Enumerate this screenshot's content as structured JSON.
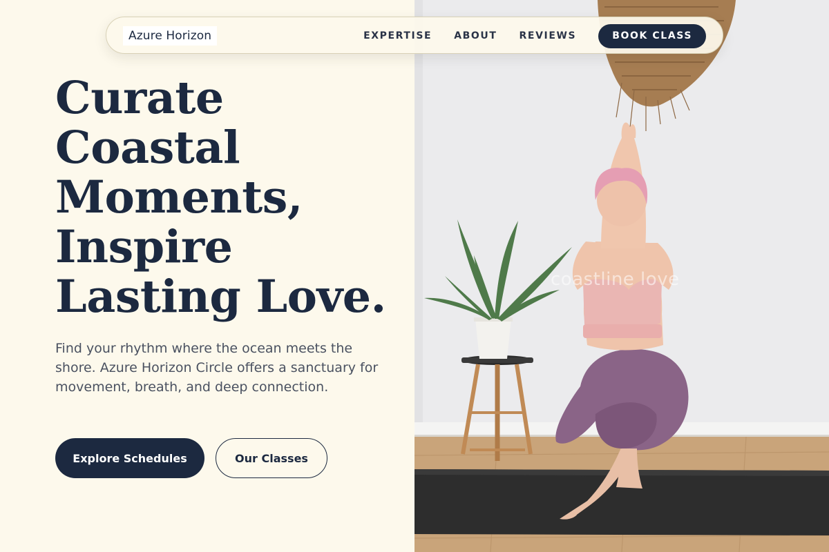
{
  "brand": {
    "name": "Azure Horizon"
  },
  "nav": {
    "links": [
      {
        "label": "EXPERTISE"
      },
      {
        "label": "ABOUT"
      },
      {
        "label": "REVIEWS"
      }
    ],
    "cta": "BOOK CLASS"
  },
  "hero": {
    "title_lines": [
      "Curate",
      "Coastal",
      "Moments,",
      "Inspire",
      "Lasting Love."
    ],
    "subtitle": "Find your rhythm where the ocean meets the shore. Azure Horizon Circle offers a sanctuary for movement, breath, and deep connection.",
    "primary_button": "Explore Schedules",
    "secondary_button": "Our Classes"
  },
  "photo": {
    "watermark": "coastline love",
    "subject": "yoga-practitioner-in-eagle-pose",
    "props": [
      "woven-pendant-lamp",
      "aloe-plant",
      "wooden-stool",
      "yoga-mat"
    ]
  },
  "colors": {
    "background": "#fdf9ec",
    "navy": "#1c2940",
    "body_text": "#4a5160"
  }
}
